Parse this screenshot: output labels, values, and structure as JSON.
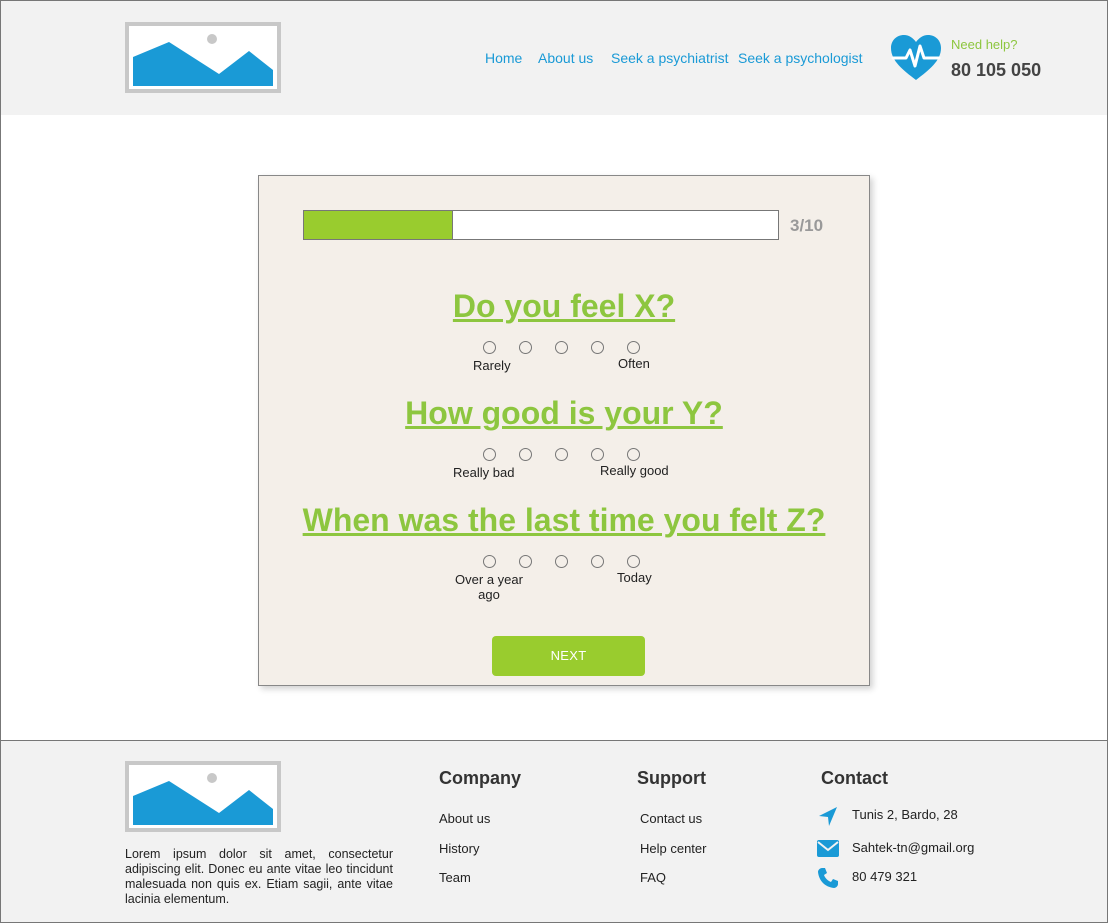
{
  "header": {
    "nav": [
      "Home",
      "About us",
      "Seek a psychiatrist",
      "Seek a psychologist"
    ],
    "help_label": "Need help?",
    "help_phone": "80 105 050"
  },
  "colors": {
    "accent": "#1a9ad6",
    "brand_green": "#8dc63f",
    "button_green": "#99cc2e",
    "card_bg": "#f4efe9"
  },
  "quiz": {
    "progress_text": "3/10",
    "progress_fraction": 0.315,
    "questions": [
      {
        "text": "Do you feel X?",
        "low_label": "Rarely",
        "high_label": "Often"
      },
      {
        "text": "How good is your Y?",
        "low_label": "Really bad",
        "high_label": "Really good"
      },
      {
        "text": "When was the last time you felt Z?",
        "low_label_line1": "Over a year",
        "low_label_line2": "ago",
        "high_label": "Today"
      }
    ],
    "next_label": "NEXT"
  },
  "footer": {
    "description": "Lorem ipsum dolor sit amet, consectetur adipiscing elit. Donec eu ante vitae leo tincidunt malesuada non quis ex. Etiam sagii, ante vitae lacinia elementum.",
    "company": {
      "heading": "Company",
      "links": [
        "About us",
        "History",
        "Team"
      ]
    },
    "support": {
      "heading": "Support",
      "links": [
        "Contact us",
        "Help center",
        "FAQ"
      ]
    },
    "contact": {
      "heading": "Contact",
      "address": "Tunis 2, Bardo, 28",
      "email": "Sahtek-tn@gmail.org",
      "phone": "80 479 321"
    }
  }
}
